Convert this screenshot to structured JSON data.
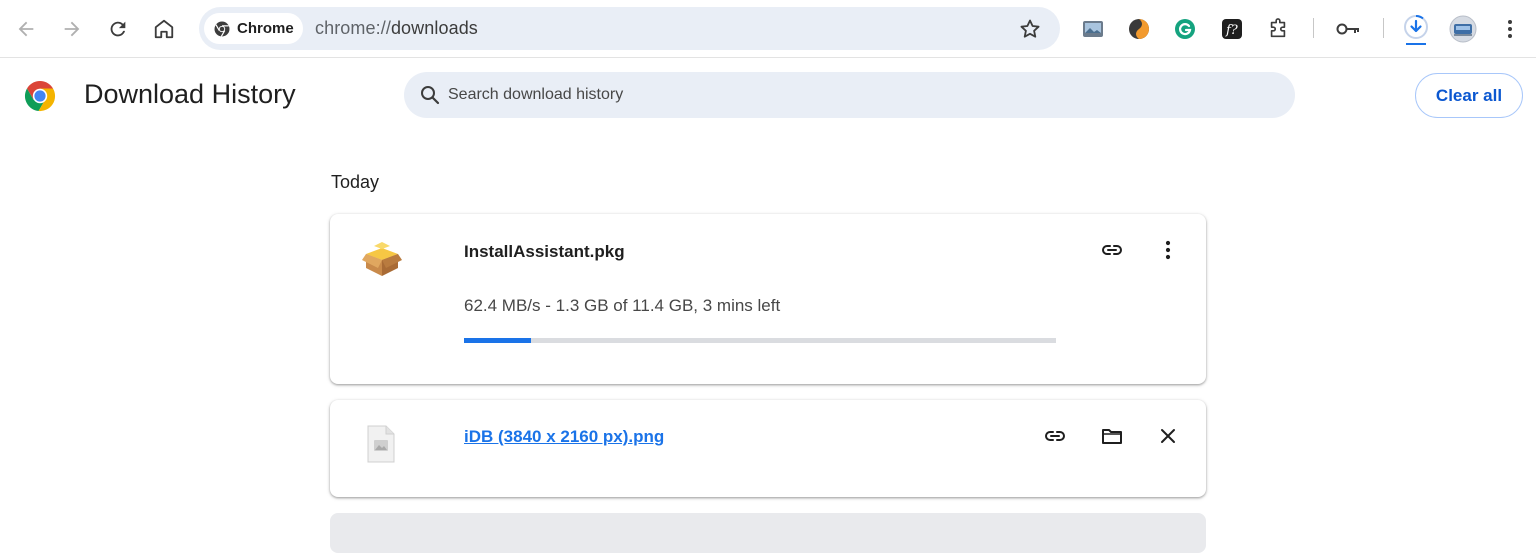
{
  "browser": {
    "chip_label": "Chrome",
    "url_scheme": "chrome://",
    "url_host": "downloads"
  },
  "page": {
    "title": "Download History",
    "search_placeholder": "Search download history",
    "clear_all_label": "Clear all",
    "section_label": "Today"
  },
  "downloads": [
    {
      "file_name": "InstallAssistant.pkg",
      "status": "62.4 MB/s - 1.3 GB of 11.4 GB, 3 mins left",
      "progress_fraction": 0.114,
      "icon": "package-icon",
      "actions": [
        "copy-link-icon",
        "more-vert-icon"
      ]
    },
    {
      "file_name": "iDB (3840 x 2160 px).png",
      "icon": "image-file-icon",
      "actions": [
        "copy-link-icon",
        "folder-icon",
        "close-icon"
      ]
    }
  ],
  "colors": {
    "accent": "#1a73e8",
    "omnibox_bg": "#e9eef6",
    "clear_all_text": "#0b57d0"
  }
}
